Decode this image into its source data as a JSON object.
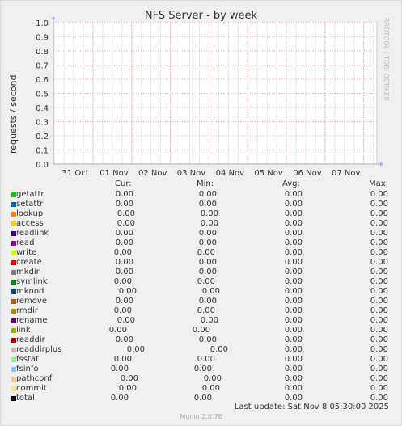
{
  "title": "NFS Server - by week",
  "watermark": "RRDTOOL / TOBI OETIKER",
  "headers": {
    "cur": "Cur:",
    "min": "Min:",
    "avg": "Avg:",
    "max": "Max:"
  },
  "last_update": "Last update: Sat Nov  8 05:30:00 2025",
  "version": "Munin 2.0.76",
  "chart_data": {
    "type": "line",
    "ylabel": "requests / second",
    "ylim": [
      0,
      1.0
    ],
    "y_ticks": [
      "0.0",
      "0.1",
      "0.2",
      "0.3",
      "0.4",
      "0.5",
      "0.6",
      "0.7",
      "0.8",
      "0.9",
      "1.0"
    ],
    "x_ticks": [
      "31 Oct",
      "01 Nov",
      "02 Nov",
      "03 Nov",
      "04 Nov",
      "05 Nov",
      "06 Nov",
      "07 Nov"
    ],
    "grid": true,
    "series": [
      {
        "name": "getattr",
        "color": "#00cc00",
        "cur": "0.00",
        "min": "0.00",
        "avg": "0.00",
        "max": "0.00"
      },
      {
        "name": "setattr",
        "color": "#0066b3",
        "cur": "0.00",
        "min": "0.00",
        "avg": "0.00",
        "max": "0.00"
      },
      {
        "name": "lookup",
        "color": "#ff8000",
        "cur": "0.00",
        "min": "0.00",
        "avg": "0.00",
        "max": "0.00"
      },
      {
        "name": "access",
        "color": "#ffcc00",
        "cur": "0.00",
        "min": "0.00",
        "avg": "0.00",
        "max": "0.00"
      },
      {
        "name": "readlink",
        "color": "#330099",
        "cur": "0.00",
        "min": "0.00",
        "avg": "0.00",
        "max": "0.00"
      },
      {
        "name": "read",
        "color": "#990099",
        "cur": "0.00",
        "min": "0.00",
        "avg": "0.00",
        "max": "0.00"
      },
      {
        "name": "write",
        "color": "#ccff00",
        "cur": "0.00",
        "min": "0.00",
        "avg": "0.00",
        "max": "0.00"
      },
      {
        "name": "create",
        "color": "#ff0000",
        "cur": "0.00",
        "min": "0.00",
        "avg": "0.00",
        "max": "0.00"
      },
      {
        "name": "mkdir",
        "color": "#808080",
        "cur": "0.00",
        "min": "0.00",
        "avg": "0.00",
        "max": "0.00"
      },
      {
        "name": "symlink",
        "color": "#008f00",
        "cur": "0.00",
        "min": "0.00",
        "avg": "0.00",
        "max": "0.00"
      },
      {
        "name": "mknod",
        "color": "#00487d",
        "cur": "0.00",
        "min": "0.00",
        "avg": "0.00",
        "max": "0.00"
      },
      {
        "name": "remove",
        "color": "#b35a00",
        "cur": "0.00",
        "min": "0.00",
        "avg": "0.00",
        "max": "0.00"
      },
      {
        "name": "rmdir",
        "color": "#b38f00",
        "cur": "0.00",
        "min": "0.00",
        "avg": "0.00",
        "max": "0.00"
      },
      {
        "name": "rename",
        "color": "#6b006b",
        "cur": "0.00",
        "min": "0.00",
        "avg": "0.00",
        "max": "0.00"
      },
      {
        "name": "link",
        "color": "#8fb300",
        "cur": "0.00",
        "min": "0.00",
        "avg": "0.00",
        "max": "0.00"
      },
      {
        "name": "readdir",
        "color": "#b30000",
        "cur": "0.00",
        "min": "0.00",
        "avg": "0.00",
        "max": "0.00"
      },
      {
        "name": "readdirplus",
        "color": "#bebebe",
        "cur": "0.00",
        "min": "0.00",
        "avg": "0.00",
        "max": "0.00"
      },
      {
        "name": "fsstat",
        "color": "#80ff80",
        "cur": "0.00",
        "min": "0.00",
        "avg": "0.00",
        "max": "0.00"
      },
      {
        "name": "fsinfo",
        "color": "#80c9ff",
        "cur": "0.00",
        "min": "0.00",
        "avg": "0.00",
        "max": "0.00"
      },
      {
        "name": "pathconf",
        "color": "#ffc080",
        "cur": "0.00",
        "min": "0.00",
        "avg": "0.00",
        "max": "0.00"
      },
      {
        "name": "commit",
        "color": "#ffe680",
        "cur": "0.00",
        "min": "0.00",
        "avg": "0.00",
        "max": "0.00"
      },
      {
        "name": "total",
        "color": "#000000",
        "cur": "0.00",
        "min": "0.00",
        "avg": "0.00",
        "max": "0.00"
      }
    ]
  }
}
